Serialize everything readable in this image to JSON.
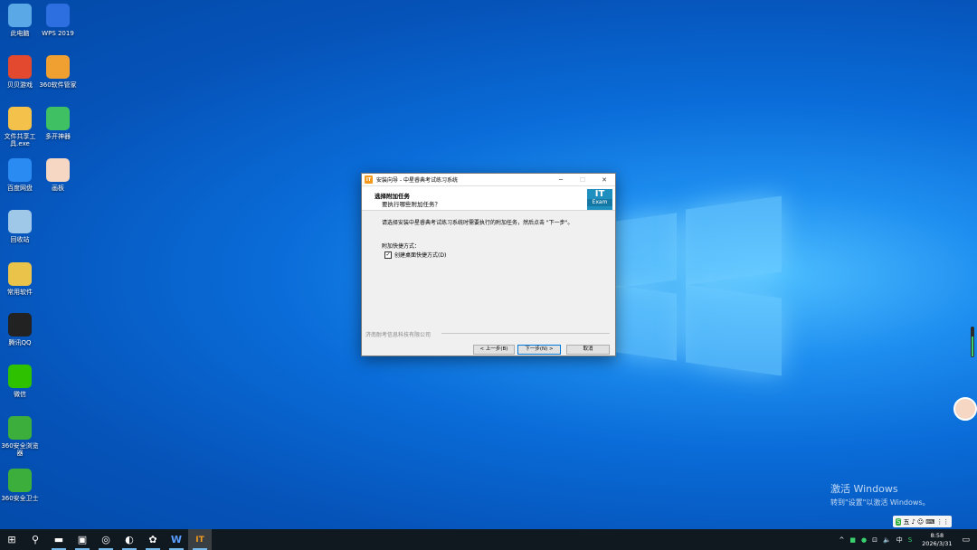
{
  "desktop_icons": [
    {
      "label": "此电脑",
      "icon": "computer-icon",
      "color": "#5aa9e6"
    },
    {
      "label": "WPS 2019",
      "icon": "wps-icon",
      "color": "#2d6fe0"
    },
    {
      "label": "贝贝游戏",
      "icon": "game-mario-icon",
      "color": "#e2492f"
    },
    {
      "label": "360软件管家",
      "icon": "360-software-icon",
      "color": "#f0a030"
    },
    {
      "label": "文件共享工具.exe",
      "icon": "folder-icon",
      "color": "#f4c14a"
    },
    {
      "label": "多开神器",
      "icon": "wechat-multi-icon",
      "color": "#3fc163"
    },
    {
      "label": "百度网盘",
      "icon": "baidu-netdisk-icon",
      "color": "#2a8bf2"
    },
    {
      "label": "画板",
      "icon": "avatar-girl-icon",
      "color": "#f5d7c4"
    },
    {
      "label": "回收站",
      "icon": "recycle-bin-icon",
      "color": "#9fc8e8"
    },
    {
      "label": "常用软件",
      "icon": "software-icon",
      "color": "#e9c34a"
    },
    {
      "label": "腾讯QQ",
      "icon": "qq-icon",
      "color": "#222222"
    },
    {
      "label": "微信",
      "icon": "wechat-icon",
      "color": "#2dc100"
    },
    {
      "label": "360安全浏览器",
      "icon": "360-browser-icon",
      "color": "#3cae3c"
    },
    {
      "label": "360安全卫士",
      "icon": "360-security-icon",
      "color": "#3cae3c"
    }
  ],
  "dialog": {
    "title": "安装向导 - 中星睿典考试练习系统",
    "heading": "选择附加任务",
    "subheading": "要执行哪些附加任务？",
    "description": "请选择安装中星睿典考试练习系统时需要执行的附加任务，然后点击 \"下一步\"。",
    "group_label": "附加快捷方式：",
    "checkbox_label": "创建桌面快捷方式(D)",
    "checkbox_checked": true,
    "logo_line1": "IT",
    "logo_line2": "Exam",
    "company": "济南耐考信息科技有限公司",
    "back_button": "< 上一步(B)",
    "next_button": "下一步(N) >",
    "cancel_button": "取消"
  },
  "watermark": {
    "line1": "激活 Windows",
    "line2": "转到\"设置\"以激活 Windows。"
  },
  "ime": {
    "chars": [
      "S",
      "五",
      "♪",
      "☺",
      "⌨",
      "⋮⋮"
    ]
  },
  "taskbar": {
    "apps": [
      {
        "name": "start-button",
        "glyph": "⊞"
      },
      {
        "name": "search-icon",
        "glyph": "⚲"
      },
      {
        "name": "file-explorer-icon",
        "glyph": "▬"
      },
      {
        "name": "store-icon",
        "glyph": "▣"
      },
      {
        "name": "360-browser-taskbar-icon",
        "glyph": "◎"
      },
      {
        "name": "edge-icon",
        "glyph": "◐"
      },
      {
        "name": "photos-icon",
        "glyph": "✿"
      },
      {
        "name": "wps-taskbar-icon",
        "glyph": "W"
      },
      {
        "name": "installer-taskbar-icon",
        "glyph": "IT"
      }
    ],
    "tray": {
      "chevron": "^",
      "ime_lang": "中",
      "time": "8:58",
      "date": "2026/3/31"
    }
  }
}
